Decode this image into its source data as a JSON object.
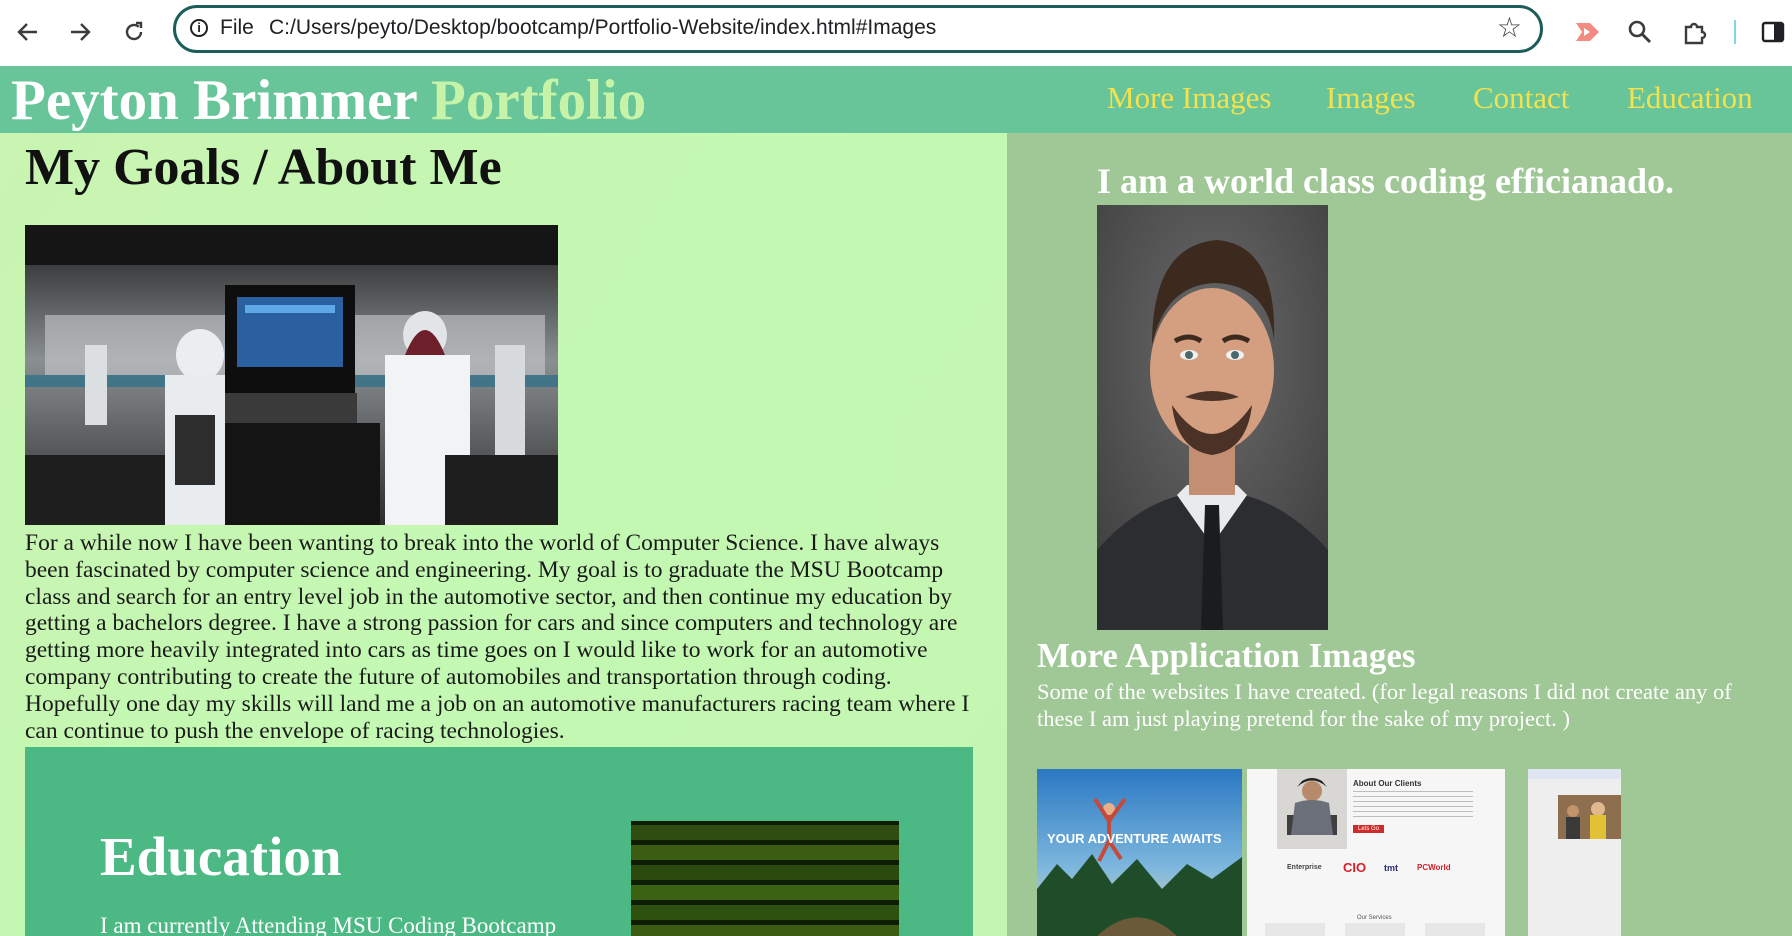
{
  "browser": {
    "file_label": "File",
    "url": "C:/Users/peyto/Desktop/bootcamp/Portfolio-Website/index.html#Images",
    "icons": [
      "back-arrow-icon",
      "forward-arrow-icon",
      "reload-icon",
      "info-icon",
      "bookmark-star-icon",
      "extension-icon",
      "zoom-icon",
      "extensions-puzzle-icon",
      "side-panel-icon"
    ]
  },
  "header": {
    "brand_name": "Peyton Brimmer",
    "brand_accent": "Portfolio",
    "nav": [
      {
        "label": "More Images"
      },
      {
        "label": "Images"
      },
      {
        "label": "Contact"
      },
      {
        "label": "Education"
      }
    ]
  },
  "about": {
    "title": "My Goals / About Me",
    "body": "For a while now I have been wanting to break into the world of Computer Science. I have always been fascinated by computer science and engineering. My goal is to graduate the MSU Bootcamp class and search for an entry level job in the automotive sector, and then continue my education by getting a bachelors degree. I have a strong passion for cars and since computers and technology are getting more heavily integrated into cars as time goes on I would like to work for an automotive company contributing to create the future of automobiles and transportation through coding. Hopefully one day my skills will land me a job on an automotive manufacturers racing team where I can continue to push the envelope of racing technologies."
  },
  "education": {
    "title": "Education",
    "body": "I am currently Attending MSU Coding Bootcamp"
  },
  "profile": {
    "tagline": "I am a world class coding efficianado."
  },
  "more_images": {
    "title": "More Application Images",
    "body": "Some of the websites I have created. (for legal reasons I did not create any of these I am just playing pretend for the sake of my project. )",
    "thumbs": [
      {
        "caption": "YOUR ADVENTURE AWAITS"
      },
      {
        "heading": "About Our Clients",
        "button": "Lets Go",
        "logos": [
          "Enterprise",
          "CIO",
          "tmt",
          "PCWorld"
        ],
        "footer": "Our Services"
      },
      {
        "caption": ""
      }
    ]
  },
  "colors": {
    "header_bg": "#67c599",
    "nav_link": "#f3e24e",
    "brand_accent": "#c7f3a8",
    "left_bg": "#c5f5b4",
    "right_bg": "#a0c796",
    "education_bg": "#4cb985",
    "omnibox_border": "#1d5d59"
  }
}
